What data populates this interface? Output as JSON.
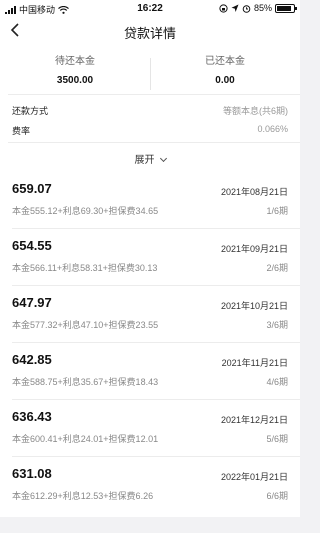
{
  "status_bar": {
    "carrier": "中国移动",
    "time": "16:22",
    "battery": "85%",
    "battery_level": 0.85
  },
  "nav": {
    "back_icon": "chevron-left-icon",
    "title": "贷款详情"
  },
  "summary": {
    "pending_label": "待还本金",
    "pending_value": "3500.00",
    "repaid_label": "已还本金",
    "repaid_value": "0.00"
  },
  "info": [
    {
      "key": "还款方式",
      "value": "等额本息(共6期)"
    },
    {
      "key": "费率",
      "value": "0.066%"
    }
  ],
  "expand_label": "展开",
  "installments": [
    {
      "amount": "659.07",
      "date": "2021年08月21日",
      "detail": "本金555.12+利息69.30+担保费34.65",
      "period": "1/6期"
    },
    {
      "amount": "654.55",
      "date": "2021年09月21日",
      "detail": "本金566.11+利息58.31+担保费30.13",
      "period": "2/6期"
    },
    {
      "amount": "647.97",
      "date": "2021年10月21日",
      "detail": "本金577.32+利息47.10+担保费23.55",
      "period": "3/6期"
    },
    {
      "amount": "642.85",
      "date": "2021年11月21日",
      "detail": "本金588.75+利息35.67+担保费18.43",
      "period": "4/6期"
    },
    {
      "amount": "636.43",
      "date": "2021年12月21日",
      "detail": "本金600.41+利息24.01+担保费12.01",
      "period": "5/6期"
    },
    {
      "amount": "631.08",
      "date": "2022年01月21日",
      "detail": "本金612.29+利息12.53+担保费6.26",
      "period": "6/6期"
    }
  ]
}
